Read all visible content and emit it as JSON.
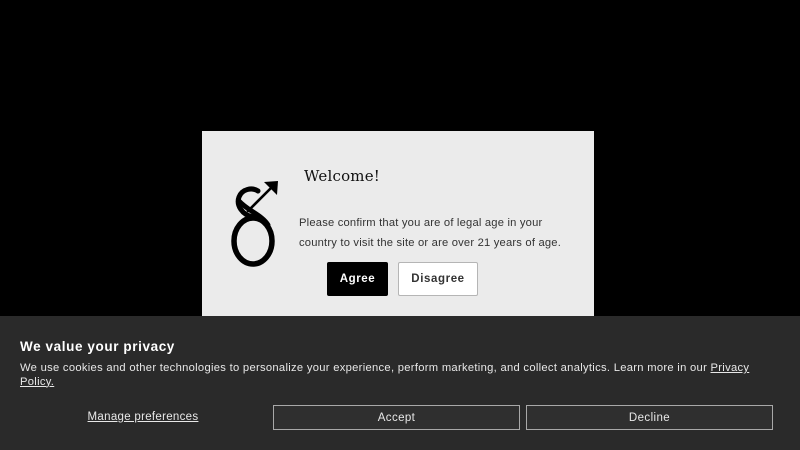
{
  "age_gate": {
    "logo_icon": "brand-monogram-icon",
    "title": "Welcome!",
    "message": "Please confirm that you are of legal age in your country to visit the site or are over 21 years of age.",
    "agree_label": "Agree",
    "disagree_label": "Disagree"
  },
  "cookie_banner": {
    "title": "We value your privacy",
    "text": "We use cookies and other technologies to personalize your experience, perform marketing, and collect analytics. Learn more in our ",
    "privacy_link_label": "Privacy Policy.",
    "manage_label": "Manage preferences",
    "accept_label": "Accept",
    "decline_label": "Decline"
  },
  "colors": {
    "background": "#000000",
    "modal_background": "#ebebeb",
    "banner_background": "#2a2a2a",
    "agree_button": "#000000"
  }
}
